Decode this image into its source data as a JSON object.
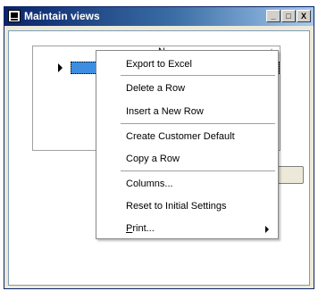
{
  "window": {
    "title": "Maintain views"
  },
  "titlebar_buttons": {
    "minimize": "_",
    "maximize": "□",
    "close": "X"
  },
  "grid": {
    "header": "N"
  },
  "context_menu": {
    "items": [
      "Export to Excel",
      "Delete a Row",
      "Insert a New Row",
      "Create Customer Default",
      "Copy a Row",
      "Columns...",
      "Reset to Initial Settings"
    ],
    "print_first": "P",
    "print_rest": "rint..."
  }
}
